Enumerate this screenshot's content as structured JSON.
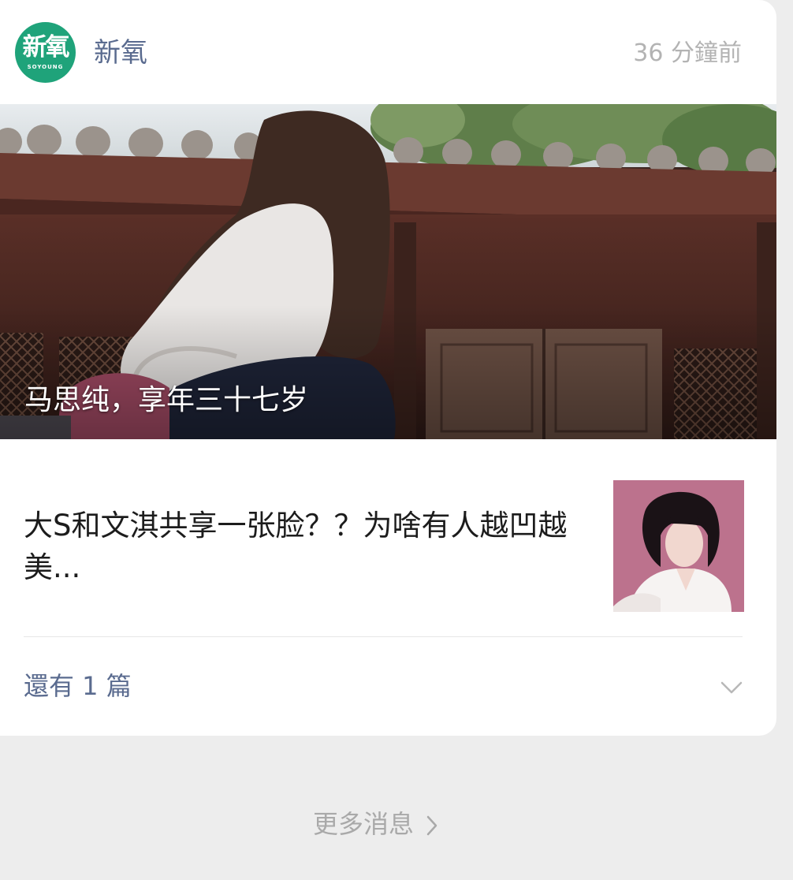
{
  "source": {
    "logo_text": "新氧",
    "logo_subtext": "SOYOUNG",
    "name": "新氧",
    "time": "36 分鐘前",
    "brand_color": "#1fa37a"
  },
  "hero": {
    "caption": "马思纯，享年三十七岁",
    "image_description_icon": "photo-icon"
  },
  "article": {
    "title": "大S和文淇共享一张脸？？为啥有人越凹越美..."
  },
  "footer": {
    "more_count_label": "還有 1 篇",
    "more_news_label": "更多消息"
  },
  "colors": {
    "link": "#5a6b8f",
    "muted": "#b3b3b3",
    "background": "#ededed"
  }
}
